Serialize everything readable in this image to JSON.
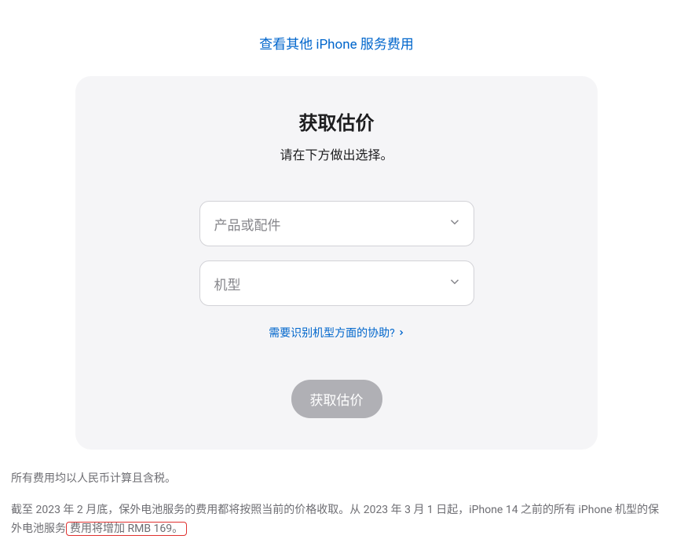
{
  "top_link": {
    "label": "查看其他 iPhone 服务费用"
  },
  "card": {
    "title": "获取估价",
    "subtitle": "请在下方做出选择。",
    "select_product_placeholder": "产品或配件",
    "select_model_placeholder": "机型",
    "help_link_label": "需要识别机型方面的协助?",
    "button_label": "获取估价"
  },
  "footer": {
    "line1": "所有费用均以人民币计算且含税。",
    "line2_part1": "截至 2023 年 2 月底，保外电池服务的费用都将按照当前的价格收取。从 2023 年 3 月 1 日起，iPhone 14 之前的所有 iPhone 机型的保外电池服务",
    "line2_highlight": "费用将增加 RMB 169。"
  }
}
